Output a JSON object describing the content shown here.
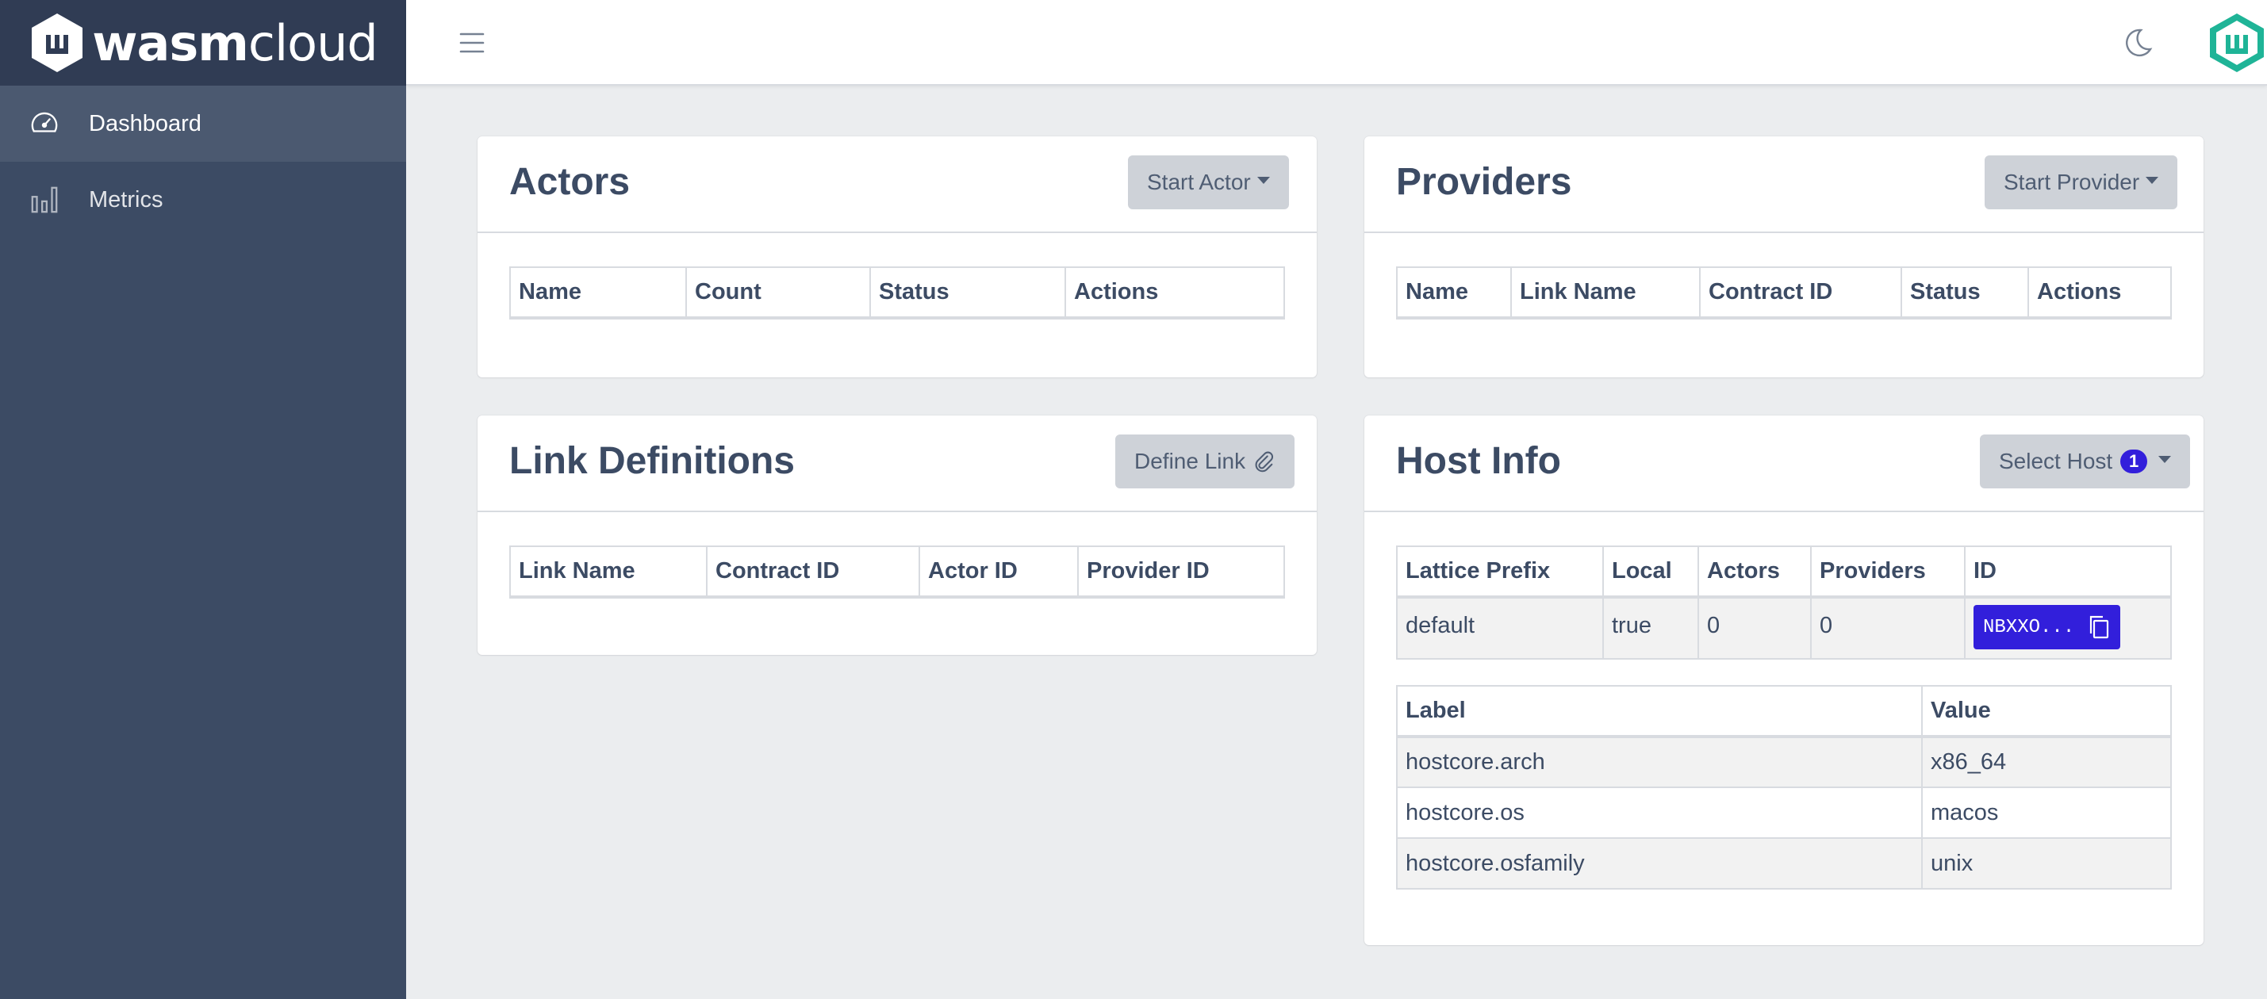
{
  "brand": {
    "text_bold": "wasm",
    "text_light": "cloud"
  },
  "sidebar": {
    "items": [
      {
        "label": "Dashboard",
        "icon": "speedometer-icon",
        "active": true
      },
      {
        "label": "Metrics",
        "icon": "bar-chart-icon",
        "active": false
      }
    ]
  },
  "header": {
    "menu_icon": "hamburger-icon",
    "theme_icon": "moon-icon",
    "avatar_icon": "wasmcloud-logo-icon"
  },
  "actors": {
    "title": "Actors",
    "button": "Start Actor",
    "columns": [
      "Name",
      "Count",
      "Status",
      "Actions"
    ]
  },
  "providers": {
    "title": "Providers",
    "button": "Start Provider",
    "columns": [
      "Name",
      "Link Name",
      "Contract ID",
      "Status",
      "Actions"
    ]
  },
  "links": {
    "title": "Link Definitions",
    "button": "Define Link",
    "button_icon": "paperclip-icon",
    "columns": [
      "Link Name",
      "Contract ID",
      "Actor ID",
      "Provider ID"
    ]
  },
  "host": {
    "title": "Host Info",
    "button": "Select Host",
    "badge": "1",
    "columns": [
      "Lattice Prefix",
      "Local",
      "Actors",
      "Providers",
      "ID"
    ],
    "row": {
      "prefix": "default",
      "local": "true",
      "actors": "0",
      "providers": "0",
      "id": "NBXXO..."
    },
    "id_icon": "copy-icon",
    "label_columns": [
      "Label",
      "Value"
    ],
    "labels": [
      {
        "label": "hostcore.arch",
        "value": "x86_64"
      },
      {
        "label": "hostcore.os",
        "value": "macos"
      },
      {
        "label": "hostcore.osfamily",
        "value": "unix"
      }
    ]
  },
  "colors": {
    "sidebar": "#3c4b64",
    "brand_bg": "#303c54",
    "primary": "#321fdb",
    "accent": "#1fb497",
    "page_bg": "#ebedef"
  }
}
